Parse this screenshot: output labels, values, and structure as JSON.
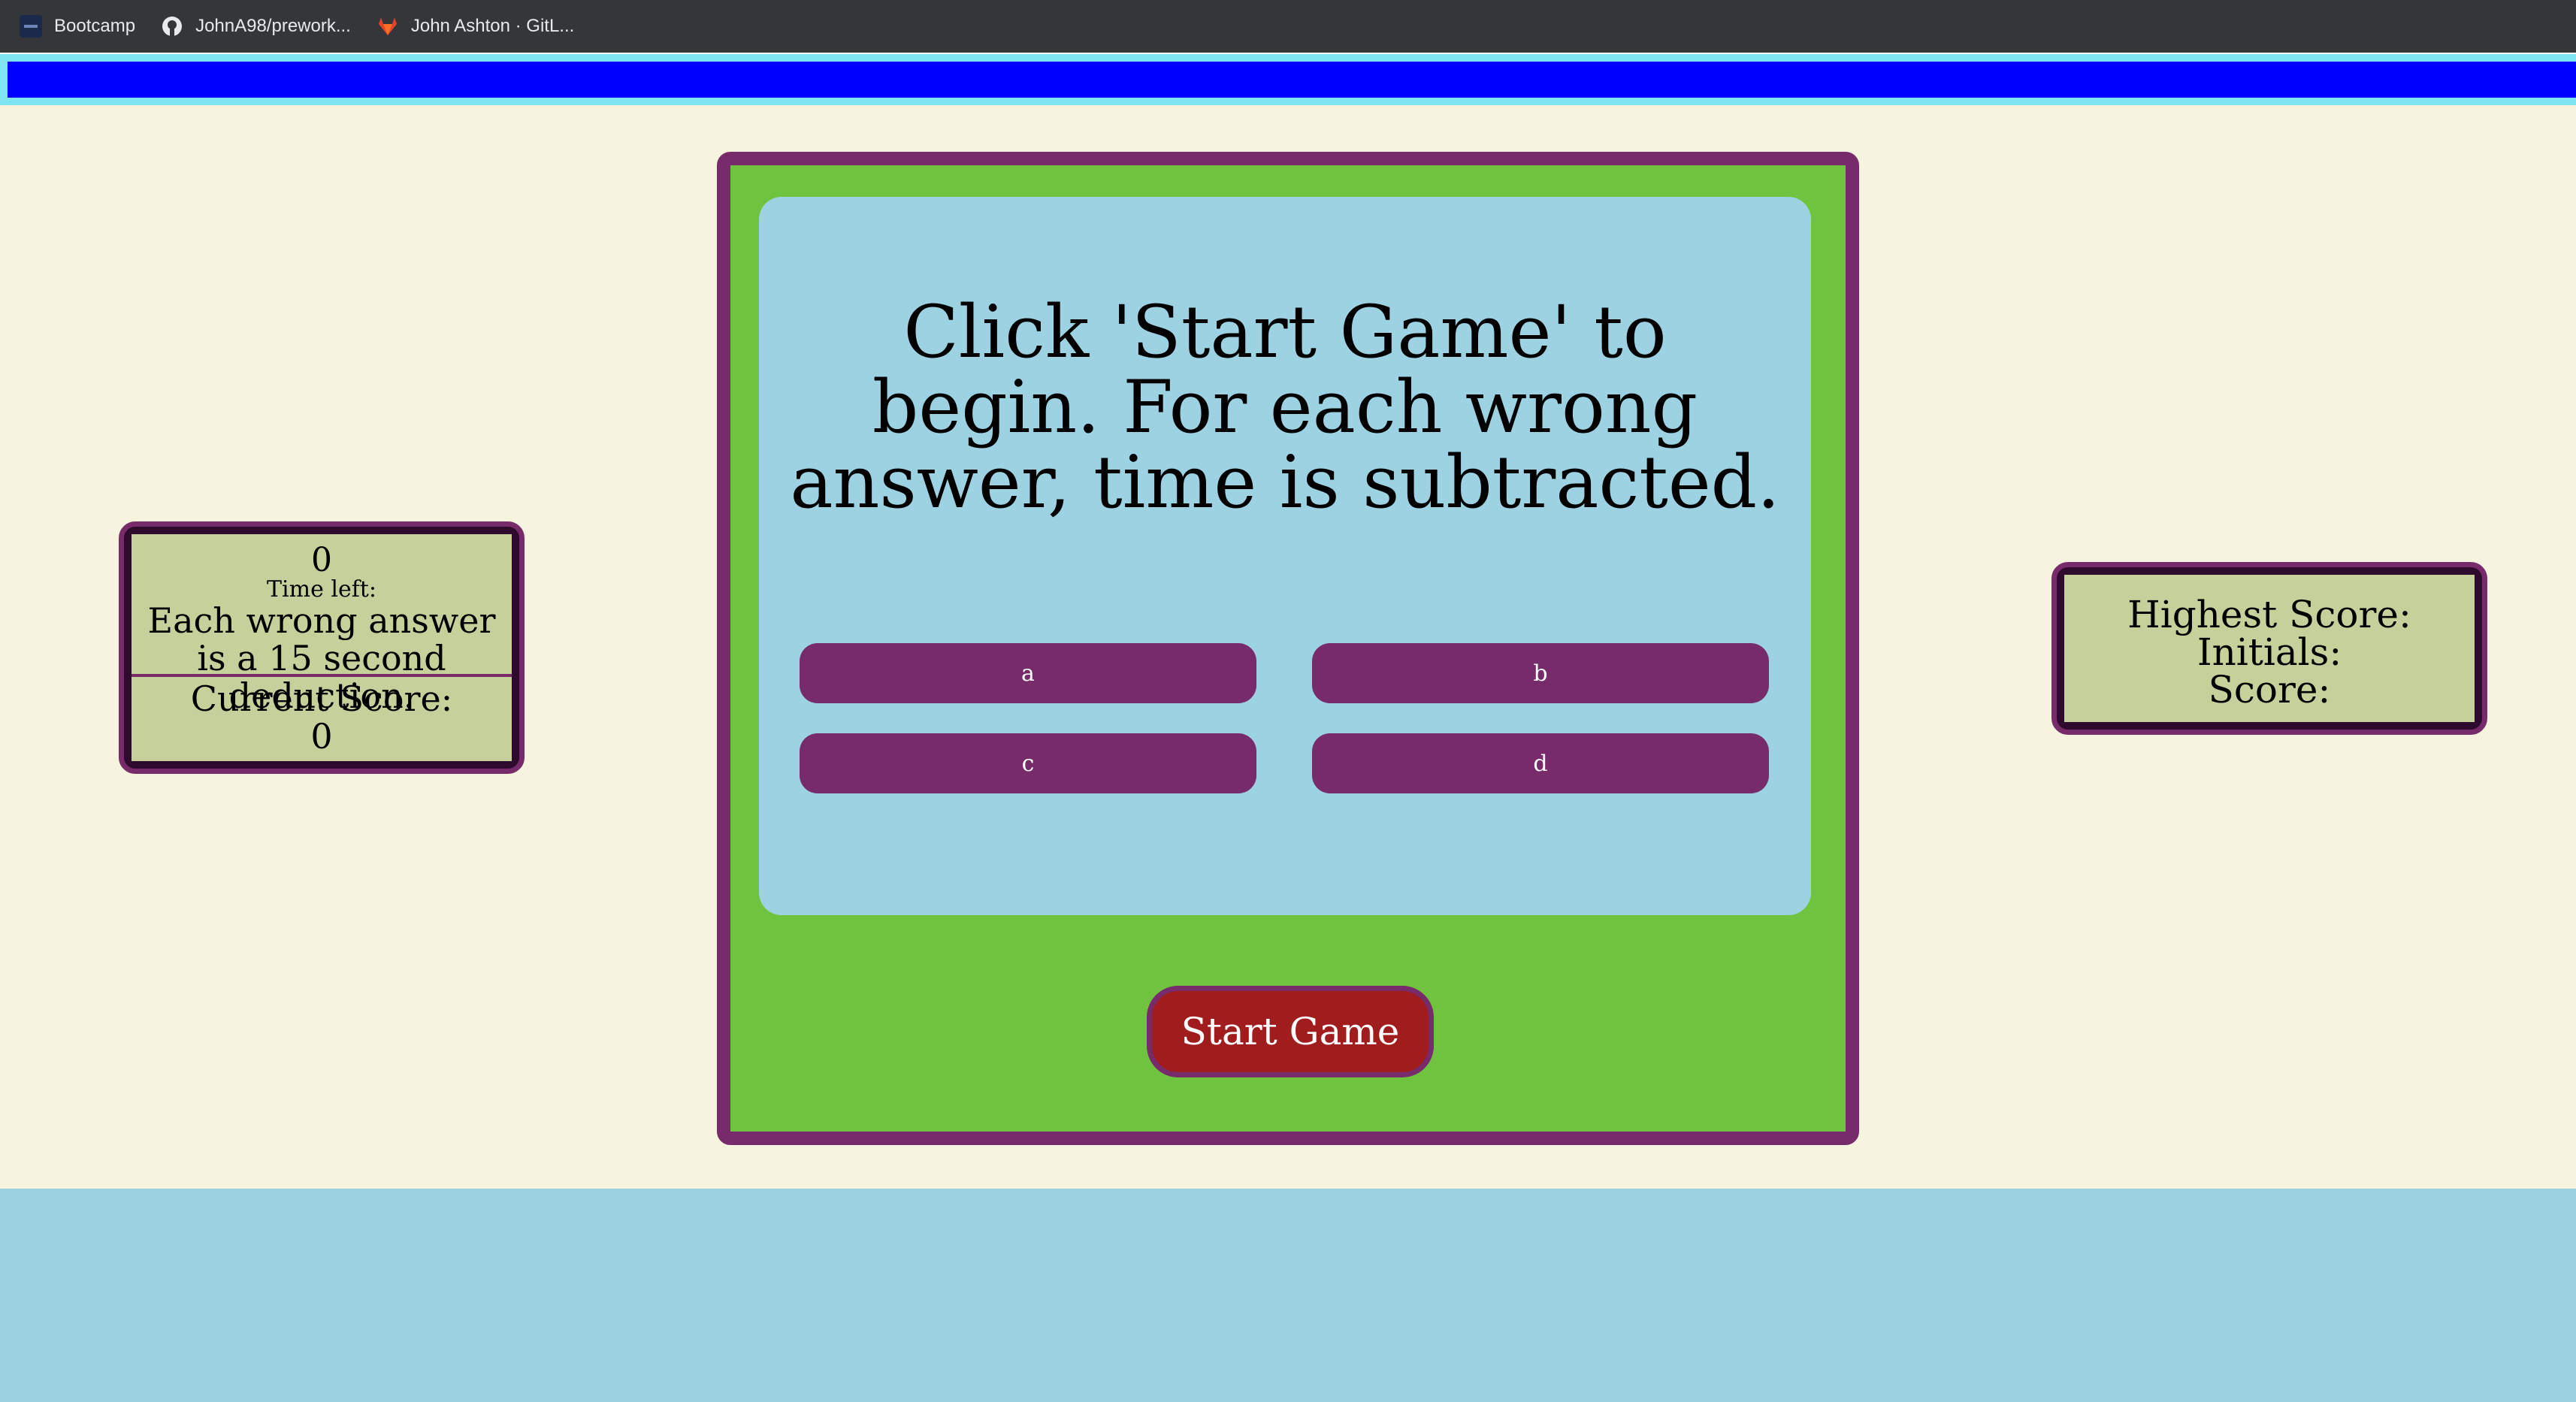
{
  "bookmarks": [
    {
      "label": "Bootcamp",
      "icon": "bootcamp-icon"
    },
    {
      "label": "JohnA98/prework...",
      "icon": "github-icon"
    },
    {
      "label": "John Ashton · GitL...",
      "icon": "gitlab-icon"
    }
  ],
  "timer": {
    "count": "0",
    "label": "Time left:",
    "note": "Each wrong answer is a 15 second deduction.",
    "score_label": "Current Score:",
    "score_value": "0"
  },
  "highscore": {
    "title": "Highest Score:",
    "initials_label": "Initials:",
    "score_label": "Score:"
  },
  "game": {
    "question": "Click 'Start Game' to begin. For each wrong answer, time is subtracted.",
    "answers": [
      "a",
      "b",
      "c",
      "d"
    ],
    "start_label": "Start Game"
  },
  "colors": {
    "progress_bar": "#0000ff",
    "card_green": "#6fc33e",
    "card_border": "#772b6b",
    "question_bg": "#9dd2e2",
    "start_button": "#a11d1d",
    "panel_bg": "#c5d09b",
    "page_bg": "#f6f4de"
  }
}
